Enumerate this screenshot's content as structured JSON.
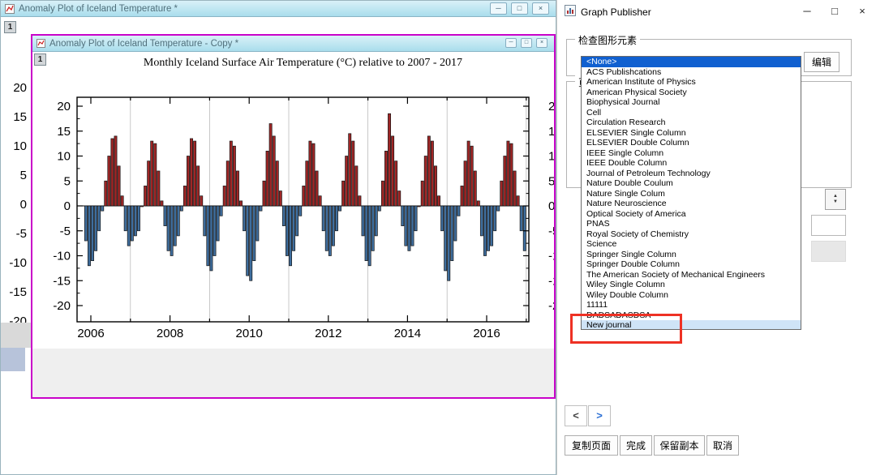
{
  "theme": {
    "titlebar_gradient_top": "#d9f1f8",
    "titlebar_gradient_bottom": "#a9ddec",
    "titlebar_text": "#51707c",
    "window_highlight_border": "#c903c9",
    "list_selection_bg": "#1060d0",
    "list_highlight_bg": "#cfe4f7",
    "annotation_red": "#ee3124",
    "nav_next_arrow": "#2b6fd4"
  },
  "icons": {
    "minimize": "─",
    "restore": "□",
    "maximize": "□",
    "close": "×",
    "spinner_up": "▲",
    "spinner_down": "▼",
    "nav_prev": "<",
    "nav_next": ">"
  },
  "window1": {
    "title": "Anomaly Plot of Iceland Temperature *",
    "page_badge": "1",
    "y_axis_labels": [
      "20",
      "15",
      "10",
      "5",
      "0",
      "-5",
      "-10",
      "-15",
      "-20"
    ]
  },
  "window2": {
    "title": "Anomaly Plot of Iceland Temperature - Copy *",
    "page_badge": "1"
  },
  "chart_data": {
    "type": "bar",
    "title": "Monthly Iceland Surface Air Temperature (°C) relative to 2007 - 2017",
    "xlabel": "",
    "ylabel": "",
    "y_ticks": [
      20,
      15,
      10,
      5,
      0,
      -5,
      -10,
      -15,
      -20
    ],
    "y_minor_ticks": [
      17.5,
      12.5,
      7.5,
      2.5,
      -2.5,
      -7.5,
      -12.5,
      -17.5
    ],
    "x_tick_labels": [
      "2006",
      "2008",
      "2010",
      "2012",
      "2014",
      "2016"
    ],
    "gridline_years": [
      2007,
      2009,
      2011,
      2013,
      2015,
      2017
    ],
    "ylim": [
      -22.5,
      22.5
    ],
    "xlim": [
      2005.65,
      2017.07
    ],
    "grid": true,
    "series_start": {
      "year": 2005,
      "month": 11
    },
    "monthly_anomaly_values": [
      -7,
      -12,
      -11,
      -9,
      -5,
      -1,
      5,
      10,
      13.5,
      14,
      8,
      2,
      -5,
      -8,
      -7,
      -6,
      -5,
      0,
      4,
      9,
      13,
      12.5,
      7,
      1,
      -4,
      -9,
      -10,
      -8,
      -6,
      -1,
      4,
      10,
      13.5,
      13,
      8,
      2,
      -6,
      -12,
      -13,
      -10,
      -7,
      -2,
      4,
      9,
      13,
      12,
      7,
      1,
      -5,
      -14,
      -15,
      -11,
      -7,
      -1,
      5,
      11,
      16.5,
      14,
      9,
      3,
      -4,
      -10,
      -12,
      -9,
      -6,
      -2,
      4,
      9,
      13,
      12.5,
      7,
      2,
      -5,
      -9,
      -10,
      -8,
      -5,
      -1,
      5,
      10,
      14.5,
      13,
      8,
      2,
      -6,
      -11,
      -12,
      -9,
      -6,
      -1,
      5,
      11,
      18.5,
      14,
      9,
      3,
      -4,
      -8,
      -9,
      -8,
      -5,
      0,
      5,
      10,
      14,
      13,
      8,
      2,
      -5,
      -13,
      -15,
      -11,
      -7,
      -2,
      4,
      9,
      13,
      12,
      7,
      1,
      -6,
      -10,
      -9,
      -8,
      -5,
      -1,
      5,
      10,
      13,
      12.5,
      7,
      2,
      -5,
      -9
    ],
    "colors": {
      "positive_bar": "#a02626",
      "negative_bar": "#3f6e9e",
      "bar_outline": "#151515",
      "gridline": "#bbbbbb"
    }
  },
  "publisher": {
    "title": "Graph Publisher",
    "group_inspect": {
      "label": "检查图形元素",
      "edit_button": "编辑"
    },
    "group_page": {
      "label": "页"
    },
    "journal_list": {
      "items": [
        "<None>",
        "ACS Publishcations",
        "American Institute of Physics",
        "American Physical Society",
        "Biophysical Journal",
        "Cell",
        "Circulation Research",
        "ELSEVIER Single Column",
        "ELSEVIER Double Column",
        "IEEE Single Column",
        "IEEE Double Column",
        "Journal of Petroleum Technology",
        "Nature Double Coulum",
        "Nature Single Colum",
        "Nature Neuroscience",
        "Optical Society of America",
        "PNAS",
        "Royal Society of Chemistry",
        "Science",
        "Springer Single Column",
        "Springer Double Column",
        "The American Society of Mechanical Engineers",
        "Wiley Single Column",
        "Wiley Double Column",
        "11111",
        "DADSADASDSA",
        "New journal"
      ],
      "selected_index": 0,
      "highlighted_index": 26
    },
    "footer": {
      "copy_page": "复制页面",
      "done": "完成",
      "keep_copy": "保留副本",
      "cancel": "取消"
    }
  }
}
